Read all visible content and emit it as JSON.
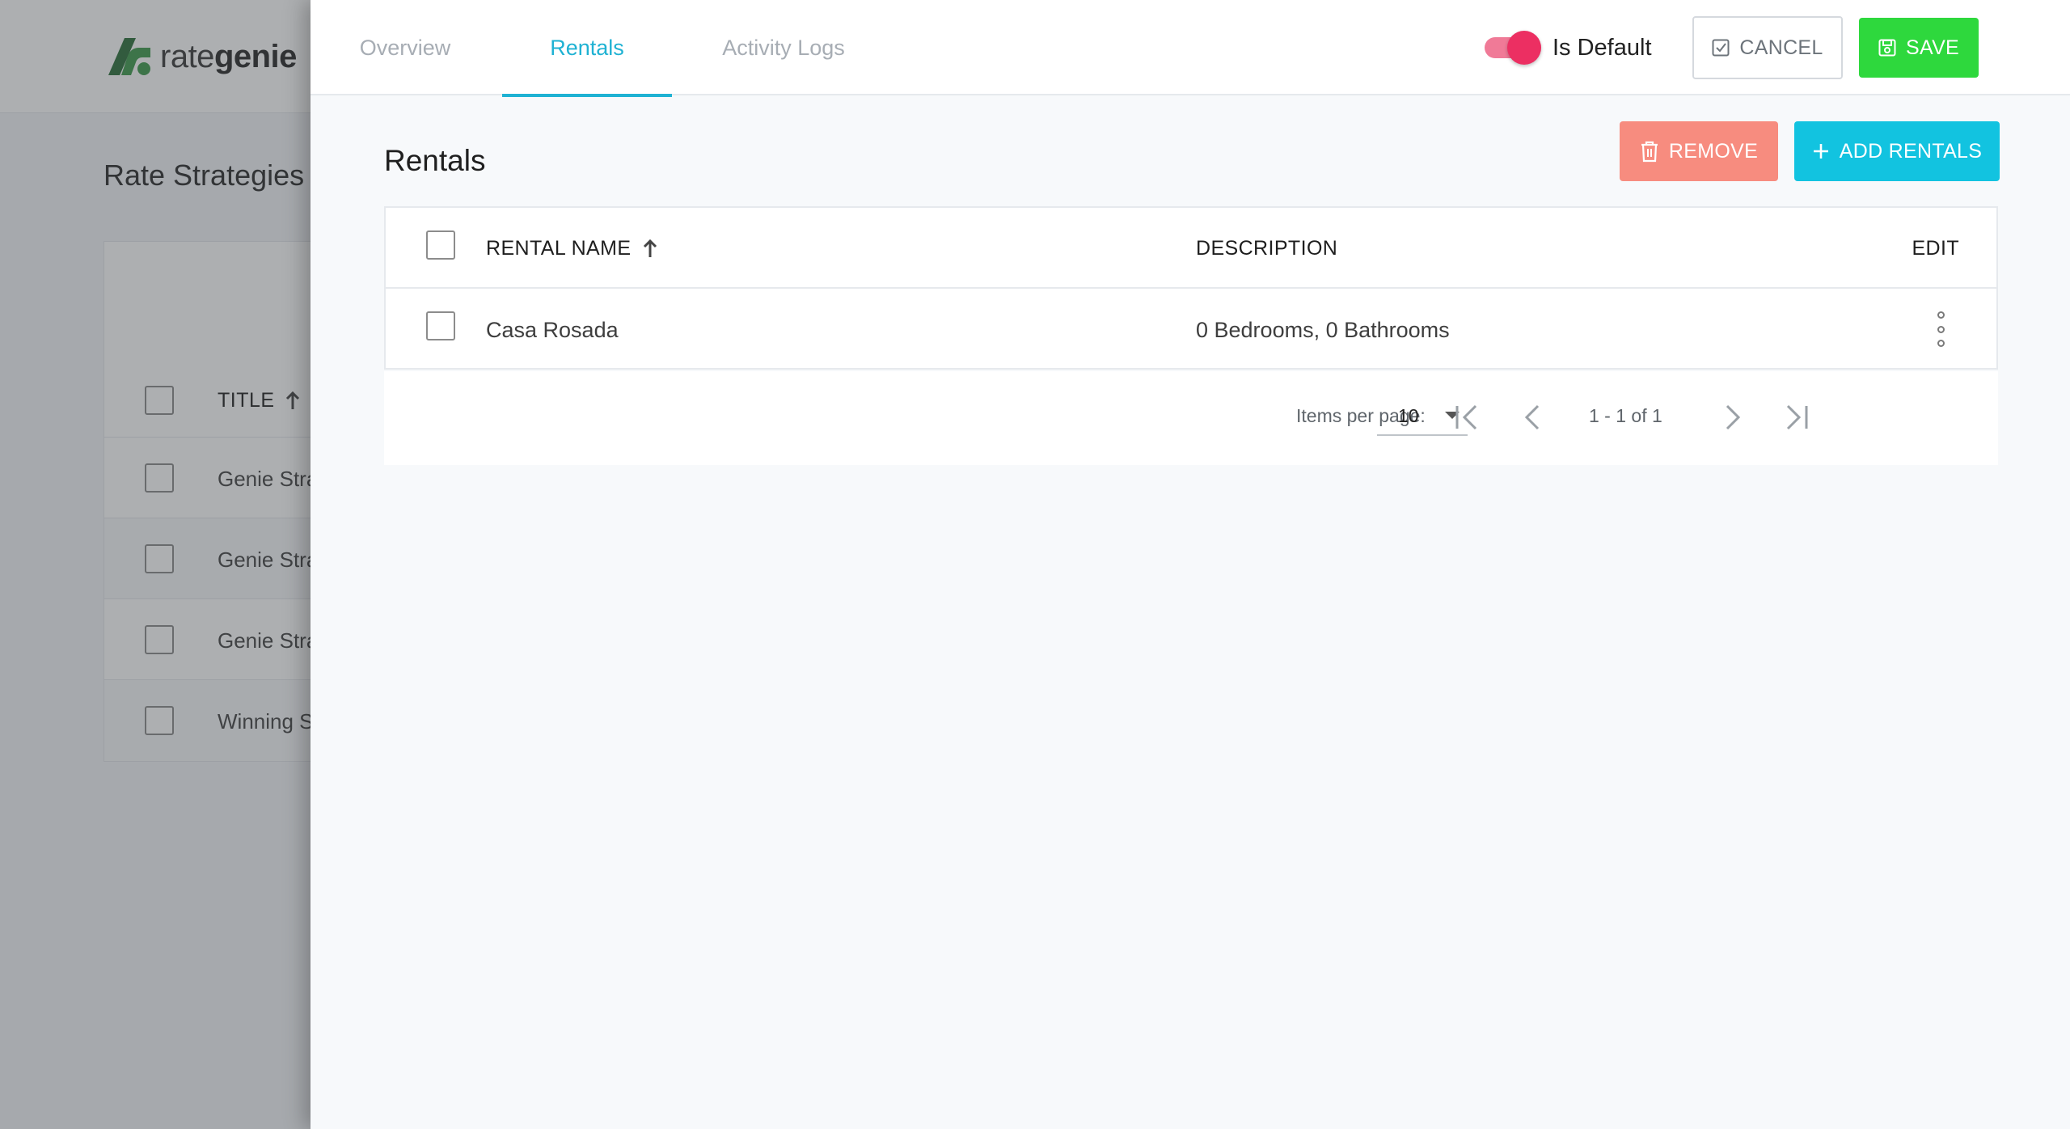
{
  "app": {
    "brand_light": "rate",
    "brand_bold": "genie",
    "page_title": "Rate Strategies"
  },
  "background_table": {
    "header_title": "TITLE",
    "rows": [
      "Genie Stra",
      "Genie Stra",
      "Genie Stra",
      "Winning S"
    ]
  },
  "drawer": {
    "tabs": [
      {
        "label": "Overview",
        "active": false
      },
      {
        "label": "Rentals",
        "active": true
      },
      {
        "label": "Activity Logs",
        "active": false
      }
    ],
    "is_default_label": "Is Default",
    "is_default_on": true,
    "cancel_label": "CANCEL",
    "save_label": "SAVE",
    "section_title": "Rentals",
    "remove_label": "REMOVE",
    "add_label": "ADD RENTALS"
  },
  "table": {
    "columns": {
      "name": "RENTAL NAME",
      "description": "DESCRIPTION",
      "edit": "EDIT"
    },
    "rows": [
      {
        "name": "Casa Rosada",
        "description": "0 Bedrooms, 0 Bathrooms"
      }
    ]
  },
  "paginator": {
    "items_per_page_label": "Items per page:",
    "items_per_page_value": "10",
    "range_label": "1 - 1 of 1"
  },
  "colors": {
    "accent_tab": "#1fb2d3",
    "save": "#2ed83d",
    "remove": "#f78c7f",
    "add": "#12c3e0",
    "toggle": "#ec2f62"
  }
}
